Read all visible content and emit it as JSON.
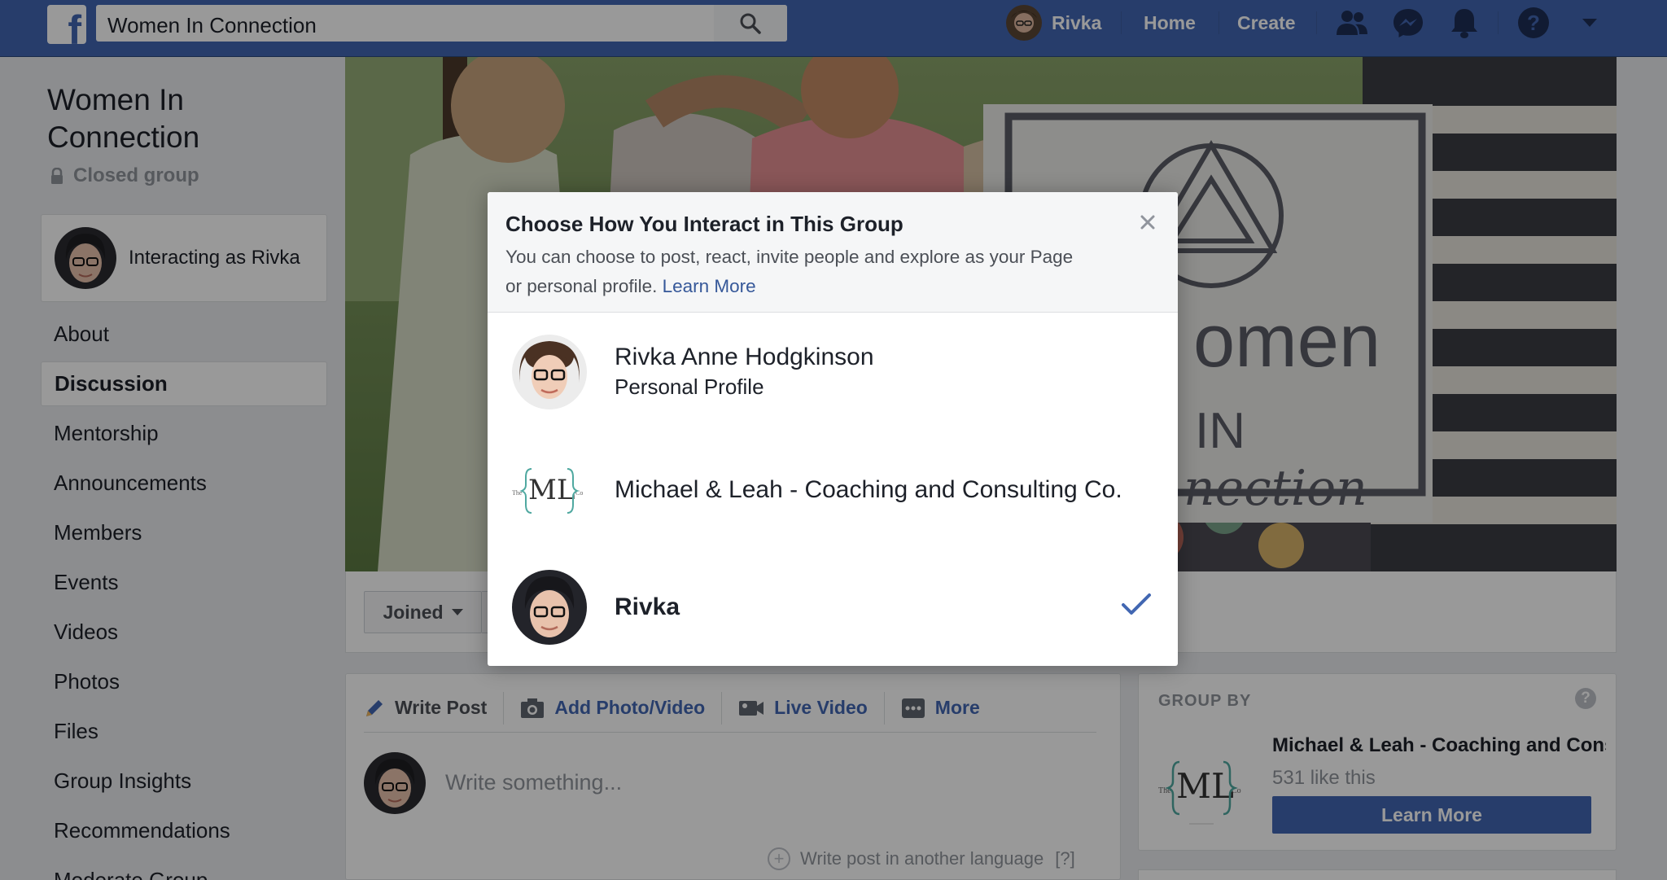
{
  "topbar": {
    "search_value": "Women In Connection",
    "user_name": "Rivka",
    "home_label": "Home",
    "create_label": "Create",
    "icons": [
      "facebook-logo",
      "search-icon",
      "friends-icon",
      "messenger-icon",
      "notifications-icon",
      "help-icon",
      "caret-down-icon"
    ],
    "brand_color": "#4267b2"
  },
  "group": {
    "title": "Women In Connection",
    "privacy": "Closed group",
    "interacting_as": "Interacting as Rivka"
  },
  "sidebar": {
    "items": [
      {
        "label": "About"
      },
      {
        "label": "Discussion",
        "active": true
      },
      {
        "label": "Mentorship"
      },
      {
        "label": "Announcements"
      },
      {
        "label": "Members"
      },
      {
        "label": "Events"
      },
      {
        "label": "Videos"
      },
      {
        "label": "Photos"
      },
      {
        "label": "Files"
      },
      {
        "label": "Group Insights"
      },
      {
        "label": "Recommendations"
      },
      {
        "label": "Moderate Group"
      }
    ]
  },
  "cover": {
    "logo_text_1": "omen",
    "logo_text_2": "IN",
    "logo_text_3": "nection",
    "joined_label": "Joined"
  },
  "composer": {
    "tabs": [
      "Write Post",
      "Add Photo/Video",
      "Live Video",
      "More"
    ],
    "placeholder": "Write something...",
    "other_language": "Write post in another language",
    "help": "[?]"
  },
  "group_by": {
    "heading": "GROUP BY",
    "page_name": "Michael & Leah - Coaching and Consulting Co.",
    "likes": "531 like this",
    "button": "Learn More",
    "help": "?"
  },
  "modal": {
    "title": "Choose How You Interact in This Group",
    "description": "You can choose to post, react, invite people and explore as your Page or personal profile.",
    "learn_more": "Learn More",
    "options": [
      {
        "name": "Rivka Anne Hodgkinson",
        "subtitle": "Personal Profile",
        "selected": false
      },
      {
        "name": "Michael & Leah - Coaching and Consulting Co.",
        "subtitle": "",
        "selected": false
      },
      {
        "name": "Rivka",
        "subtitle": "",
        "selected": true
      }
    ],
    "check_color": "#4267b2"
  },
  "logo_monogram": {
    "left": "The",
    "letters": "ML",
    "right": "Co"
  }
}
